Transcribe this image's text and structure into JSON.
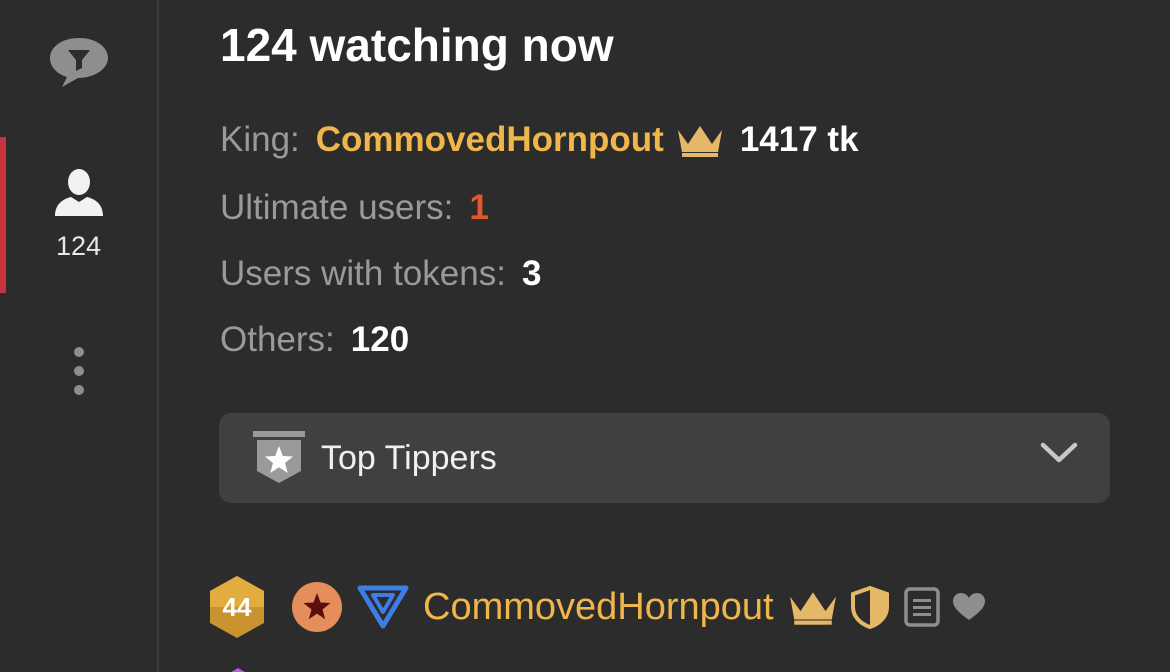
{
  "sidebar": {
    "chat_icon": "chat-bubble-filter-icon",
    "users_icon": "user-icon",
    "users_count": "124",
    "more_icon": "vertical-dots-icon",
    "active_color": "#c8343c"
  },
  "main": {
    "title": "124 watching now",
    "king": {
      "label": "King:",
      "name": "CommovedHornpout",
      "icon": "crown-icon",
      "tokens": "1417 tk"
    },
    "ultimate": {
      "label": "Ultimate users:",
      "value": "1"
    },
    "with_tokens": {
      "label": "Users with tokens:",
      "value": "3"
    },
    "others": {
      "label": "Others:",
      "value": "120"
    },
    "top_tippers": {
      "label": "Top Tippers",
      "icon": "star-shield-icon",
      "chevron": "chevron-down-icon"
    },
    "user": {
      "level": "44",
      "name": "CommovedHornpout",
      "icons": [
        "level-badge-icon",
        "star-badge-icon",
        "triangle-badge-icon",
        "crown-icon",
        "half-shield-icon",
        "notes-icon",
        "heart-icon"
      ]
    }
  },
  "colors": {
    "accent_gold": "#f0b64a",
    "ultimate_orange": "#e3572a",
    "background": "#2c2c2d",
    "panel": "#404041"
  }
}
